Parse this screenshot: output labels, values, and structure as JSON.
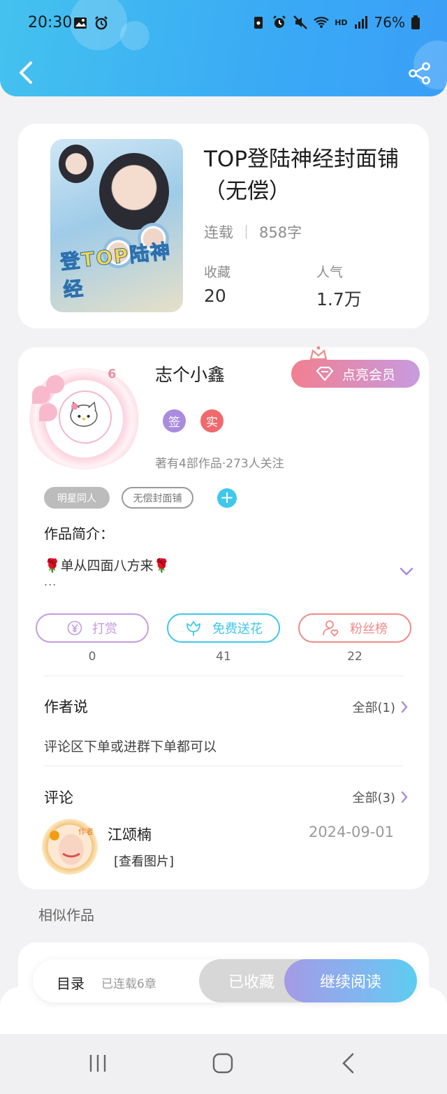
{
  "status_bar": {
    "time": "20:30",
    "battery": "76%",
    "hd": "HD"
  },
  "book": {
    "title": "TOP登陆神经封面铺（无偿）",
    "status": "连载",
    "word_count": "858字",
    "cover_text": "登TOP陆神经",
    "stats": [
      {
        "label": "收藏",
        "value": "20"
      },
      {
        "label": "人气",
        "value": "1.7万"
      }
    ]
  },
  "author": {
    "name": "志个小鑫",
    "vip_label": "点亮会员",
    "badges": [
      {
        "text": "签",
        "color": "#a98be0"
      },
      {
        "text": "实",
        "color": "#f0696c"
      }
    ],
    "meta": "著有4部作品·273人关注",
    "level": "6"
  },
  "tags": [
    "明星同人",
    "无偿封面铺"
  ],
  "intro": {
    "label": "作品简介：",
    "text": "单从四面八方来",
    "ellipsis": "..."
  },
  "actions": [
    {
      "label": "打赏",
      "count": "0",
      "color": "#c59be0"
    },
    {
      "label": "免费送花",
      "count": "41",
      "color": "#3fc7ec"
    },
    {
      "label": "粉丝榜",
      "count": "22",
      "color": "#f08a8a"
    }
  ],
  "author_says": {
    "title": "作者说",
    "more": "全部(1)",
    "text": "评论区下单或进群下单都可以"
  },
  "comments": {
    "title": "评论",
    "more": "全部(3)",
    "items": [
      {
        "name": "江颂楠",
        "date": "2024-09-01",
        "text": "[查看图片]",
        "avatar_tag": "作者"
      }
    ]
  },
  "similar": {
    "title": "相似作品"
  },
  "bottom_bar": {
    "toc_label": "目录",
    "toc_sub": "已连载6章",
    "collected": "已收藏",
    "continue": "继续阅读"
  },
  "colors": {
    "header_start": "#44c2ee",
    "header_end": "#3a9ff7",
    "accent_purple": "#a98be0",
    "accent_cyan": "#3fc7ec"
  }
}
